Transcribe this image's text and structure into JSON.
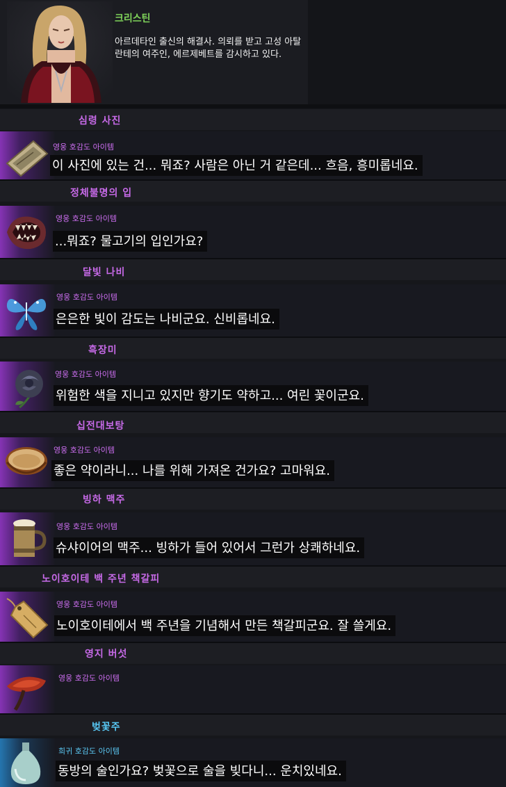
{
  "character": {
    "name": "크리스틴",
    "description": "아르데타인 출신의 해결사. 의뢰를 받고 고성 아탈란테의 여주인, 에르제베트를 감시하고 있다."
  },
  "items": [
    {
      "title": "심령 사진",
      "grade": "영웅 호감도 아이템",
      "quote": "이 사진에 있는 건... 뭐죠? 사람은 아닌 거 같은데... 흐음, 흥미롭네요.",
      "icon": "old-photo-icon"
    },
    {
      "title": "정체불명의 입",
      "grade": "영웅 호감도 아이템",
      "quote": "...뭐죠? 물고기의 입인가요?",
      "icon": "fanged-mouth-icon"
    },
    {
      "title": "달빛 나비",
      "grade": "영웅 호감도 아이템",
      "quote": "은은한 빛이 감도는 나비군요. 신비롭네요.",
      "icon": "butterfly-icon"
    },
    {
      "title": "흑장미",
      "grade": "영웅 호감도 아이템",
      "quote": "위험한 색을 지니고 있지만 향기도 약하고... 여린 꽃이군요.",
      "icon": "black-rose-icon"
    },
    {
      "title": "십전대보탕",
      "grade": "영웅 호감도 아이템",
      "quote": "좋은 약이라니... 나를 위해 가져온 건가요? 고마워요.",
      "icon": "medicine-bowl-icon"
    },
    {
      "title": "빙하 맥주",
      "grade": "영웅 호감도 아이템",
      "quote": "슈샤이어의 맥주... 빙하가 들어 있어서 그런가 상쾌하네요.",
      "icon": "beer-mug-icon"
    },
    {
      "title": "노이호이테 백 주년 책갈피",
      "grade": "영웅 호감도 아이템",
      "quote": "노이호이테에서 백 주년을 기념해서 만든 책갈피군요. 잘 쓸게요.",
      "icon": "bookmark-tag-icon"
    },
    {
      "title": "영지 버섯",
      "grade": "영웅 호감도 아이템",
      "quote": "",
      "icon": "reishi-mushroom-icon"
    },
    {
      "title": "벚꽃주",
      "grade": "희귀 호감도 아이템",
      "quote": "동방의 술인가요? 벚꽃으로 술을 빚다니... 운치있네요.",
      "icon": "liquor-bottle-icon"
    }
  ],
  "colors": {
    "hero_grade": "#cc6ef0",
    "rare_grade": "#5bc7f2",
    "character_name": "#7fd35a"
  }
}
